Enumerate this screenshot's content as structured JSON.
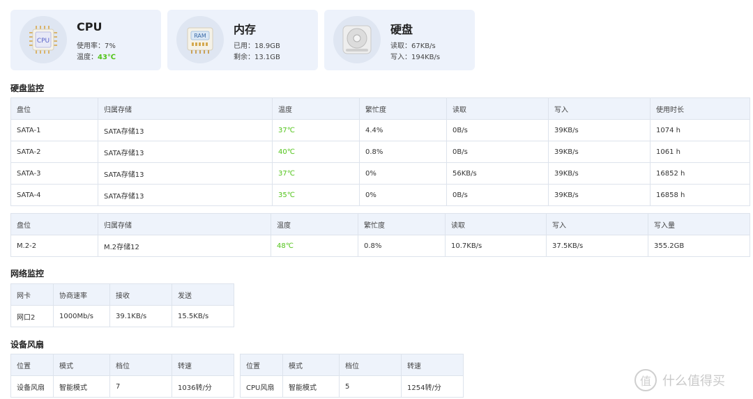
{
  "cards": {
    "cpu": {
      "icon_text": "CPU",
      "title": "CPU",
      "usage_label": "使用率：",
      "usage_value": "7%",
      "temp_label": "温度：",
      "temp_value": "43℃"
    },
    "mem": {
      "icon_text": "RAM",
      "title": "内存",
      "used_label": "已用：",
      "used_value": "18.9GB",
      "free_label": "剩余：",
      "free_value": "13.1GB"
    },
    "disk": {
      "title": "硬盘",
      "read_label": "读取：",
      "read_value": "67KB/s",
      "write_label": "写入：",
      "write_value": "194KB/s"
    }
  },
  "disk_monitor": {
    "title": "硬盘监控",
    "sata_headers": [
      "盘位",
      "归属存储",
      "温度",
      "繁忙度",
      "读取",
      "写入",
      "使用时长"
    ],
    "sata_rows": [
      [
        "SATA-1",
        "SATA存储13",
        "37℃",
        "4.4%",
        "0B/s",
        "39KB/s",
        "1074 h"
      ],
      [
        "SATA-2",
        "SATA存储13",
        "40℃",
        "0.8%",
        "0B/s",
        "39KB/s",
        "1061 h"
      ],
      [
        "SATA-3",
        "SATA存储13",
        "37℃",
        "0%",
        "56KB/s",
        "39KB/s",
        "16852 h"
      ],
      [
        "SATA-4",
        "SATA存储13",
        "35℃",
        "0%",
        "0B/s",
        "39KB/s",
        "16858 h"
      ]
    ],
    "m2_headers": [
      "盘位",
      "归属存储",
      "温度",
      "繁忙度",
      "读取",
      "写入",
      "写入量"
    ],
    "m2_rows": [
      [
        "M.2-2",
        "M.2存储12",
        "48℃",
        "0.8%",
        "10.7KB/s",
        "37.5KB/s",
        "355.2GB"
      ]
    ]
  },
  "network_monitor": {
    "title": "网络监控",
    "headers": [
      "网卡",
      "协商速率",
      "接收",
      "发送"
    ],
    "rows": [
      [
        "网口2",
        "1000Mb/s",
        "39.1KB/s",
        "15.5KB/s"
      ]
    ]
  },
  "fans": {
    "title": "设备风扇",
    "headers": [
      "位置",
      "模式",
      "档位",
      "转速"
    ],
    "device_row": [
      "设备风扇",
      "智能模式",
      "7",
      "1036转/分"
    ],
    "cpu_row": [
      "CPU风扇",
      "智能模式",
      "5",
      "1254转/分"
    ]
  },
  "watermark": {
    "text": "什么值得买",
    "logo": "值"
  },
  "colors": {
    "temp_green": "#52c41a",
    "header_bg": "#eef3fb",
    "card_bg": "#edf2fb"
  }
}
